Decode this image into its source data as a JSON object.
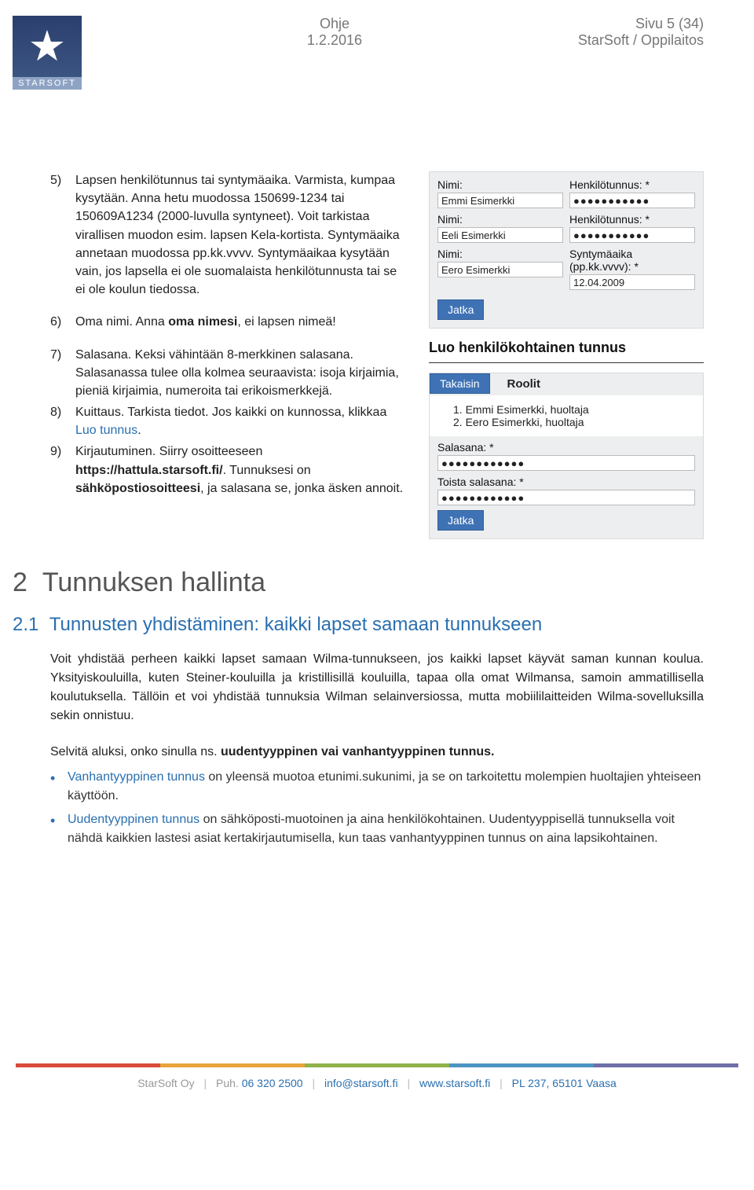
{
  "header": {
    "logo_text": "STARSOFT",
    "mid1": "Ohje",
    "mid2": "1.2.2016",
    "right1": "Sivu 5 (34)",
    "right2": "StarSoft / Oppilaitos"
  },
  "list1": {
    "n5": "5)",
    "t5a": "Lapsen henkilötunnus tai syntymäaika. Varmista, kumpaa kysytään. Anna hetu muodossa 150699-1234 tai 150609A1234 (2000-luvulla syntyneet). Voit tarkistaa virallisen muodon esim. lapsen Kela-kortista. Syntymäaika annetaan muodossa pp.kk.vvvv. Syntymäaikaa kysytään vain, jos lapsella ei ole suomalaista henkilötunnusta tai se ei ole koulun tiedossa.",
    "n6": "6)",
    "t6a": "Oma nimi. Anna ",
    "t6b": "oma nimesi",
    "t6c": ", ei lapsen nimeä!",
    "n7": "7)",
    "t7": "Salasana. Keksi vähintään 8-merkkinen salasana. Salasanassa tulee olla kolmea seuraavista: isoja kirjaimia, pieniä kirjaimia, numeroita tai erikoismerkkejä.",
    "n8": "8)",
    "t8a": "Kuittaus. Tarkista tiedot. Jos kaikki on kunnossa, klikkaa ",
    "t8b": "Luo tunnus",
    "t8c": ".",
    "n9": "9)",
    "t9a": "Kirjautuminen. Siirry osoitteeseen ",
    "t9b": "https://hattula.starsoft.fi/",
    "t9c": ". Tunnuksesi on ",
    "t9d": "sähköpostiosoitteesi",
    "t9e": ", ja salasana se, jonka äsken annoit."
  },
  "panel1": {
    "lbl_nimi": "Nimi:",
    "lbl_hetu": "Henkilötunnus: *",
    "lbl_synt": "Syntymäaika (pp.kk.vvvv): *",
    "name1": "Emmi Esimerkki",
    "name2": "Eeli Esimerkki",
    "name3": "Eero Esimerkki",
    "dots": "●●●●●●●●●●●",
    "date3": "12.04.2009",
    "btn": "Jatka"
  },
  "panel2": {
    "title": "Luo henkilökohtainen tunnus",
    "back": "Takaisin",
    "roolit": "Roolit",
    "r1": "1. Emmi Esimerkki, huoltaja",
    "r2": "2. Eero Esimerkki, huoltaja",
    "lbl_pw": "Salasana: *",
    "lbl_pw2": "Toista salasana: *",
    "dots": "●●●●●●●●●●●●",
    "btn": "Jatka"
  },
  "section": {
    "num": "2",
    "title": "Tunnuksen hallinta",
    "sub_num": "2.1",
    "sub_title": "Tunnusten yhdistäminen: kaikki lapset samaan tunnukseen"
  },
  "para1": "Voit yhdistää perheen kaikki lapset samaan Wilma-tunnukseen, jos kaikki lapset käyvät saman kunnan koulua. Yksityiskouluilla, kuten Steiner-kouluilla ja kristillisillä kouluilla, tapaa olla omat Wilmansa, samoin ammatillisella koulutuksella. Tällöin et voi yhdistää tunnuksia Wilman selainversiossa, mutta mobiililaitteiden Wilma-sovelluksilla sekin onnistuu.",
  "para2a": "Selvitä aluksi, onko sinulla ns. ",
  "para2b": "uudentyyppinen vai vanhantyyppinen tunnus.",
  "bul1a": "Vanhantyyppinen tunnus",
  "bul1b": " on yleensä muotoa etunimi.sukunimi, ja se on tarkoitettu molempien huoltajien yhteiseen käyttöön.",
  "bul2a": "Uudentyyppinen tunnus",
  "bul2b": " on sähköposti-muotoinen ja aina henkilökohtainen. Uudentyyppisellä tunnuksella voit nähdä kaikkien lastesi asiat kertakirjautumisella, kun taas vanhantyyppinen tunnus on aina lapsikohtainen.",
  "footer": {
    "company": "StarSoft Oy",
    "phone_lbl": "Puh. ",
    "phone": "06 320 2500",
    "email": "info@starsoft.fi",
    "web": "www.starsoft.fi",
    "addr": "PL 237, 65101 Vaasa"
  }
}
